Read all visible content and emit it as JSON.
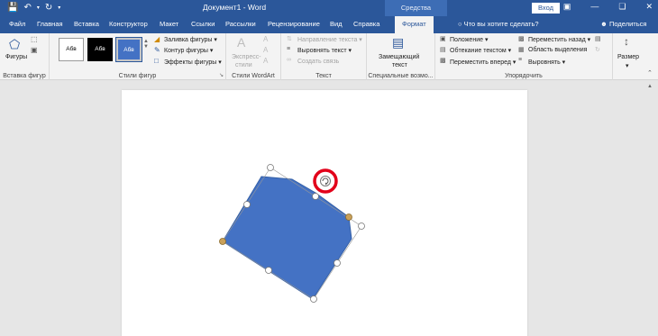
{
  "app": {
    "title": "Документ1  -  Word",
    "contextual_header": "Средства рисования",
    "sign_in": "Вход",
    "tell_me": "Что вы хотите сделать?",
    "share": "Поделиться"
  },
  "tabs": [
    "Файл",
    "Главная",
    "Вставка",
    "Конструктор",
    "Макет",
    "Ссылки",
    "Рассылки",
    "Рецензирование",
    "Вид",
    "Справка",
    "Формат"
  ],
  "active_tab": "Формат",
  "ribbon": {
    "insert_shapes": {
      "shapes_label": "Фигуры",
      "group_label": "Вставка фигур"
    },
    "shape_styles": {
      "styles": [
        "Абв",
        "Абв",
        "Абв"
      ],
      "fill": "Заливка фигуры",
      "outline": "Контур фигуры",
      "effects": "Эффекты фигуры",
      "group_label": "Стили фигур"
    },
    "wordart": {
      "express": "Экспресс-",
      "styles": "стили",
      "group_label": "Стили WordArt"
    },
    "text": {
      "direction": "Направление текста",
      "align": "Выровнять текст",
      "link": "Создать связь",
      "group_label": "Текст"
    },
    "accessibility": {
      "alt_text_1": "Замещающий",
      "alt_text_2": "текст",
      "group_label": "Специальные возмо..."
    },
    "arrange": {
      "position": "Положение",
      "wrap": "Обтекание текстом",
      "forward": "Переместить вперед",
      "backward": "Переместить назад",
      "selection": "Область выделения",
      "align": "Выровнять",
      "group_label": "Упорядочить"
    },
    "size": {
      "label": "Размер"
    }
  },
  "colors": {
    "title_blue": "#2b579a",
    "shape_fill": "#4472c4",
    "highlight_red": "#e2001a"
  }
}
